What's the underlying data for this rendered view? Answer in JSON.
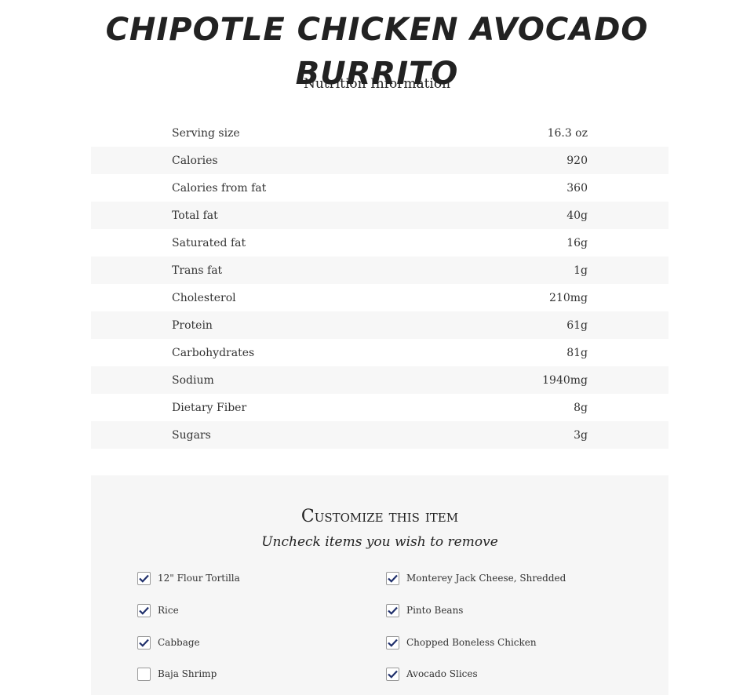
{
  "header": {
    "title_line1": "CHIPOTLE CHICKEN AVOCADO",
    "title_line2": "BURRITO",
    "subtitle": "Nutrition Information"
  },
  "nutrition": {
    "rows": [
      {
        "label": "Serving size",
        "value": "16.3 oz"
      },
      {
        "label": "Calories",
        "value": "920"
      },
      {
        "label": "Calories from fat",
        "value": "360"
      },
      {
        "label": "Total fat",
        "value": "40g"
      },
      {
        "label": "Saturated fat",
        "value": "16g"
      },
      {
        "label": "Trans fat",
        "value": "1g"
      },
      {
        "label": "Cholesterol",
        "value": "210mg"
      },
      {
        "label": "Protein",
        "value": "61g"
      },
      {
        "label": "Carbohydrates",
        "value": "81g"
      },
      {
        "label": "Sodium",
        "value": "1940mg"
      },
      {
        "label": "Dietary Fiber",
        "value": "8g"
      },
      {
        "label": "Sugars",
        "value": "3g"
      }
    ]
  },
  "customize": {
    "title": "Customize this item",
    "subtitle": "Uncheck items you wish to remove",
    "options": [
      {
        "label": "12\" Flour Tortilla",
        "checked": true
      },
      {
        "label": "Monterey Jack Cheese, Shredded",
        "checked": true
      },
      {
        "label": "Rice",
        "checked": true
      },
      {
        "label": "Pinto Beans",
        "checked": true
      },
      {
        "label": "Cabbage",
        "checked": true
      },
      {
        "label": "Chopped Boneless Chicken",
        "checked": true
      },
      {
        "label": "Baja Shrimp",
        "checked": false
      },
      {
        "label": "Avocado Slices",
        "checked": true
      }
    ]
  },
  "colors": {
    "check_mark": "#1f2f6b",
    "row_stripe": "#f7f7f7",
    "panel_bg": "#f6f6f6"
  },
  "icons": {
    "checkbox_checked": "check-icon"
  }
}
